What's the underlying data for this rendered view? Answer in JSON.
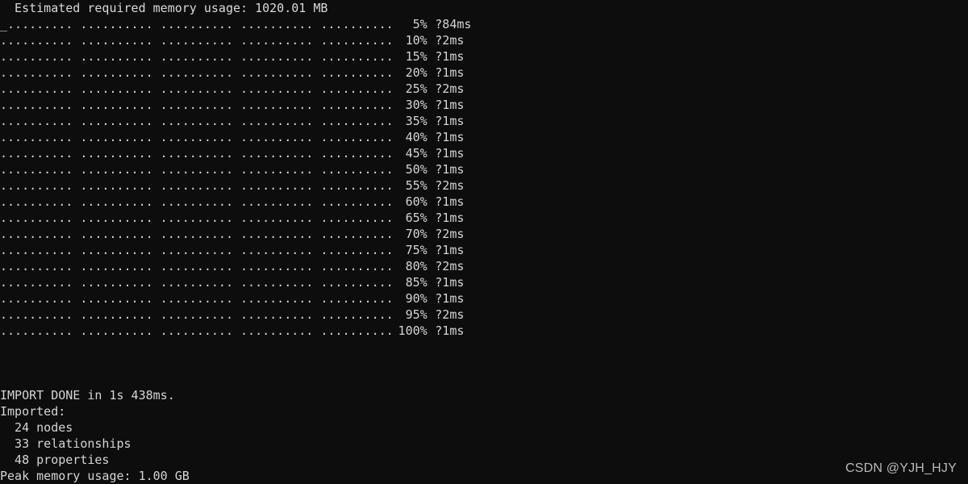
{
  "terminal": {
    "background_color": "#0d0d0d",
    "text_color": "#d4d4d4",
    "memory_estimate_line": "  Estimated required memory usage: 1020.01 MB",
    "cursor_glyph": "_",
    "dot_group": "..........",
    "dot_groups_per_row": 5,
    "dots_per_group": 10,
    "progress_rows": [
      {
        "dots": ".......... .......... .......... .......... ..........",
        "percent": "5%",
        "time": "?84ms"
      },
      {
        "dots": ".......... .......... .......... .......... ..........",
        "percent": "10%",
        "time": "?2ms"
      },
      {
        "dots": ".......... .......... .......... .......... ..........",
        "percent": "15%",
        "time": "?1ms"
      },
      {
        "dots": ".......... .......... .......... .......... ..........",
        "percent": "20%",
        "time": "?1ms"
      },
      {
        "dots": ".......... .......... .......... .......... ..........",
        "percent": "25%",
        "time": "?2ms"
      },
      {
        "dots": ".......... .......... .......... .......... ..........",
        "percent": "30%",
        "time": "?1ms"
      },
      {
        "dots": ".......... .......... .......... .......... ..........",
        "percent": "35%",
        "time": "?1ms"
      },
      {
        "dots": ".......... .......... .......... .......... ..........",
        "percent": "40%",
        "time": "?1ms"
      },
      {
        "dots": ".......... .......... .......... .......... ..........",
        "percent": "45%",
        "time": "?1ms"
      },
      {
        "dots": ".......... .......... .......... .......... ..........",
        "percent": "50%",
        "time": "?1ms"
      },
      {
        "dots": ".......... .......... .......... .......... ..........",
        "percent": "55%",
        "time": "?2ms"
      },
      {
        "dots": ".......... .......... .......... .......... ..........",
        "percent": "60%",
        "time": "?1ms"
      },
      {
        "dots": ".......... .......... .......... .......... ..........",
        "percent": "65%",
        "time": "?1ms"
      },
      {
        "dots": ".......... .......... .......... .......... ..........",
        "percent": "70%",
        "time": "?2ms"
      },
      {
        "dots": ".......... .......... .......... .......... ..........",
        "percent": "75%",
        "time": "?1ms"
      },
      {
        "dots": ".......... .......... .......... .......... ..........",
        "percent": "80%",
        "time": "?2ms"
      },
      {
        "dots": ".......... .......... .......... .......... ..........",
        "percent": "85%",
        "time": "?1ms"
      },
      {
        "dots": ".......... .......... .......... .......... ..........",
        "percent": "90%",
        "time": "?1ms"
      },
      {
        "dots": ".......... .......... .......... .......... ..........",
        "percent": "95%",
        "time": "?2ms"
      },
      {
        "dots": ".......... .......... .......... .......... ..........",
        "percent": "100%",
        "time": "?1ms"
      }
    ],
    "summary": {
      "done_line": "IMPORT DONE in 1s 438ms.",
      "imported_label": "Imported:",
      "nodes_line": "  24 nodes",
      "relationships_line": "  33 relationships",
      "properties_line": "  48 properties",
      "peak_memory_line": "Peak memory usage: 1.00 GB"
    }
  },
  "watermark": {
    "text": "CSDN @YJH_HJY"
  }
}
